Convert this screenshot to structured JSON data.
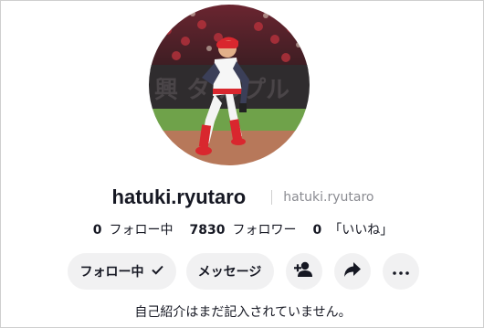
{
  "profile": {
    "username": "hatuki.ryutaro",
    "handle": "hatuki.ryutaro",
    "bio": "自己紹介はまだ記入されていません。"
  },
  "stats": [
    {
      "value": "0",
      "label": "フォロー中"
    },
    {
      "value": "7830",
      "label": "フォロワー"
    },
    {
      "value": "0",
      "label": "「いいね」"
    }
  ],
  "actions": {
    "follow_label": "フォロー中",
    "message_label": "メッセージ"
  },
  "icons": {
    "follow_check": "check-icon",
    "add_friend": "person-add-icon",
    "share": "share-arrow-icon",
    "more": "more-horizontal-icon"
  },
  "colors": {
    "text": "#161823",
    "muted": "#8a8b91",
    "button_bg": "#f1f1f2",
    "page_bg": "#ffffff"
  },
  "avatar_sign_text": "興 タ ルプル"
}
